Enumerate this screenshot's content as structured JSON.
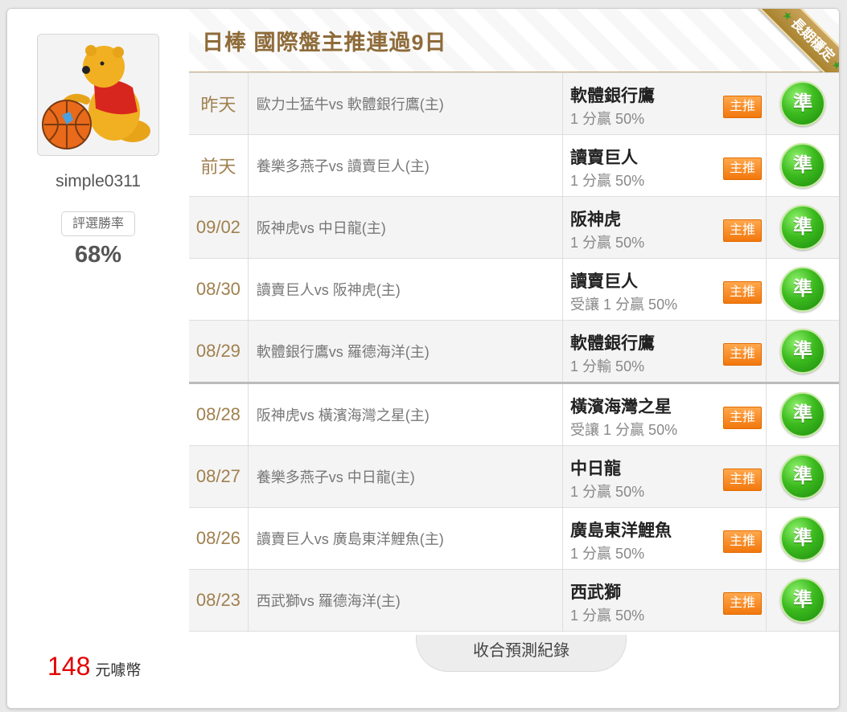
{
  "profile": {
    "username": "simple0311",
    "winrate_label": "評選勝率",
    "winrate": "68%",
    "coins_value": "148",
    "coins_unit": "元噱幣"
  },
  "header": {
    "title": "日棒 國際盤主推連過9日",
    "ribbon": "長期穩定"
  },
  "rows": [
    {
      "date": "昨天",
      "match": "歐力士猛牛vs 軟體銀行鷹(主)",
      "team": "軟體銀行鷹",
      "line": "1 分贏 50%",
      "tag": "主推",
      "result": "準"
    },
    {
      "date": "前天",
      "match": "養樂多燕子vs 讀賣巨人(主)",
      "team": "讀賣巨人",
      "line": "1 分贏 50%",
      "tag": "主推",
      "result": "準"
    },
    {
      "date": "09/02",
      "match": "阪神虎vs 中日龍(主)",
      "team": "阪神虎",
      "line": "1 分贏 50%",
      "tag": "主推",
      "result": "準"
    },
    {
      "date": "08/30",
      "match": "讀賣巨人vs 阪神虎(主)",
      "team": "讀賣巨人",
      "line": "受讓 1 分贏 50%",
      "tag": "主推",
      "result": "準"
    },
    {
      "date": "08/29",
      "match": "軟體銀行鷹vs 羅德海洋(主)",
      "team": "軟體銀行鷹",
      "line": "1 分輸 50%",
      "tag": "主推",
      "result": "準"
    },
    {
      "date": "08/28",
      "match": "阪神虎vs 橫濱海灣之星(主)",
      "team": "橫濱海灣之星",
      "line": "受讓 1 分贏 50%",
      "tag": "主推",
      "result": "準"
    },
    {
      "date": "08/27",
      "match": "養樂多燕子vs 中日龍(主)",
      "team": "中日龍",
      "line": "1 分贏 50%",
      "tag": "主推",
      "result": "準"
    },
    {
      "date": "08/26",
      "match": "讀賣巨人vs 廣島東洋鯉魚(主)",
      "team": "廣島東洋鯉魚",
      "line": "1 分贏 50%",
      "tag": "主推",
      "result": "準"
    },
    {
      "date": "08/23",
      "match": "西武獅vs 羅德海洋(主)",
      "team": "西武獅",
      "line": "1 分贏 50%",
      "tag": "主推",
      "result": "準"
    }
  ],
  "footer": {
    "collapse_label": "收合預測紀錄"
  },
  "colors": {
    "accent_gold": "#8e6b39",
    "tag_orange": "#f2770d",
    "result_green": "#3cbb1e",
    "coins_red": "#e30000"
  }
}
